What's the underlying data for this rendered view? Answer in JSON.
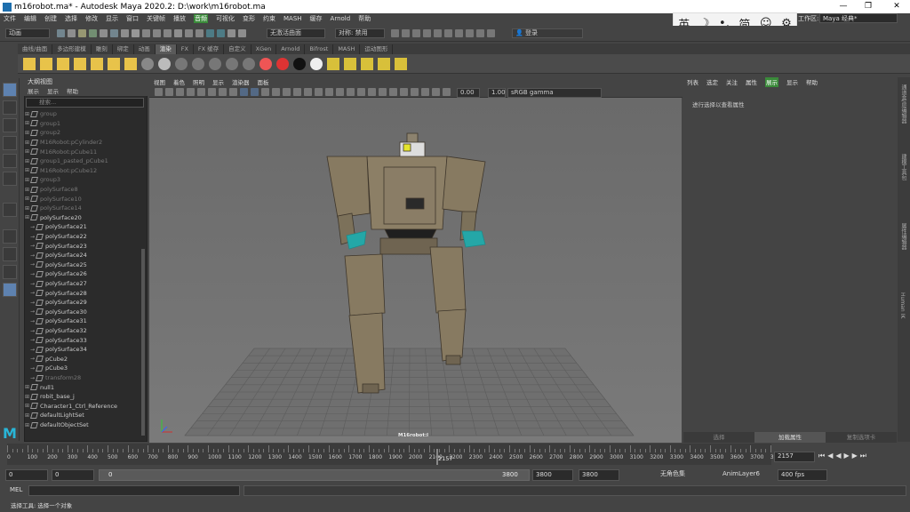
{
  "window": {
    "title": "m16robot.ma* - Autodesk Maya 2020.2: D:\\work\\m16robot.ma",
    "min": "—",
    "max": "❐",
    "close": "✕"
  },
  "menubar": [
    "文件",
    "编辑",
    "创建",
    "选择",
    "修改",
    "显示",
    "窗口",
    "关键帧",
    "播放",
    "音频",
    "可视化",
    "变形",
    "约束",
    "MASH",
    "缓存",
    "Arnold",
    "帮助"
  ],
  "menubar_highlight": "音频",
  "ime": [
    "英",
    "☽",
    "•,",
    "简",
    "☺",
    "⚙"
  ],
  "workspace": {
    "label": "工作区:",
    "value": "Maya 经典*"
  },
  "statusline": {
    "mode": "动画",
    "no_live": "无激活曲面",
    "symmetry": "对称: 禁用",
    "login": "登录"
  },
  "shelf_tabs": [
    "曲线/曲面",
    "多边形建模",
    "雕刻",
    "绑定",
    "动画",
    "渲染",
    "FX",
    "FX 缓存",
    "自定义",
    "XGen",
    "Arnold",
    "Bifrost",
    "MASH",
    "运动图形"
  ],
  "shelf_active": "渲染",
  "outliner": {
    "title": "大纲视图",
    "menu": [
      "展示",
      "显示",
      "帮助"
    ],
    "search_placeholder": "搜索...",
    "items": [
      {
        "label": "group",
        "dim": true,
        "child": false
      },
      {
        "label": "group1",
        "dim": true,
        "child": false
      },
      {
        "label": "group2",
        "dim": true,
        "child": false
      },
      {
        "label": "M16Robot:pCylinder2",
        "dim": true,
        "child": false
      },
      {
        "label": "M16Robot:pCube11",
        "dim": true,
        "child": false
      },
      {
        "label": "group1_pasted_pCube1",
        "dim": true,
        "child": false
      },
      {
        "label": "M16Robot:pCube12",
        "dim": true,
        "child": false
      },
      {
        "label": "group3",
        "dim": true,
        "child": false
      },
      {
        "label": "polySurface8",
        "dim": true,
        "child": false
      },
      {
        "label": "polySurface10",
        "dim": true,
        "child": false
      },
      {
        "label": "polySurface14",
        "dim": true,
        "child": false
      },
      {
        "label": "polySurface20",
        "dim": false,
        "child": false
      },
      {
        "label": "polySurface21",
        "dim": false,
        "child": true
      },
      {
        "label": "polySurface22",
        "dim": false,
        "child": true
      },
      {
        "label": "polySurface23",
        "dim": false,
        "child": true
      },
      {
        "label": "polySurface24",
        "dim": false,
        "child": true
      },
      {
        "label": "polySurface25",
        "dim": false,
        "child": true
      },
      {
        "label": "polySurface26",
        "dim": false,
        "child": true
      },
      {
        "label": "polySurface27",
        "dim": false,
        "child": true
      },
      {
        "label": "polySurface28",
        "dim": false,
        "child": true
      },
      {
        "label": "polySurface29",
        "dim": false,
        "child": true
      },
      {
        "label": "polySurface30",
        "dim": false,
        "child": true
      },
      {
        "label": "polySurface31",
        "dim": false,
        "child": true
      },
      {
        "label": "polySurface32",
        "dim": false,
        "child": true
      },
      {
        "label": "polySurface33",
        "dim": false,
        "child": true
      },
      {
        "label": "polySurface34",
        "dim": false,
        "child": true
      },
      {
        "label": "pCube2",
        "dim": false,
        "child": true
      },
      {
        "label": "pCube3",
        "dim": false,
        "child": true
      },
      {
        "label": "transform28",
        "dim": true,
        "child": true
      },
      {
        "label": "null1",
        "dim": false,
        "child": false
      },
      {
        "label": "robit_base_j",
        "dim": false,
        "child": false
      },
      {
        "label": "Character1_Ctrl_Reference",
        "dim": false,
        "child": false
      },
      {
        "label": "defaultLightSet",
        "dim": false,
        "child": false
      },
      {
        "label": "defaultObjectSet",
        "dim": false,
        "child": false
      }
    ]
  },
  "viewport": {
    "menu": [
      "视图",
      "着色",
      "照明",
      "显示",
      "渲染器",
      "面板"
    ],
    "exposure": "0.00",
    "gamma": "1.00",
    "color_space": "sRGB gamma",
    "camera_label": "M16robot:l"
  },
  "attribute_editor": {
    "menu": [
      "列表",
      "选定",
      "关注",
      "属性",
      "展示",
      "显示",
      "帮助"
    ],
    "menu_highlight": "展示",
    "hint": "进行选择以查看属性",
    "bottom_tabs": [
      "选择",
      "加载属性",
      "复制选项卡"
    ],
    "bottom_active": "加载属性"
  },
  "side_tabs": [
    "通道盒/层编辑器",
    "建模工具包",
    "属性编辑器",
    "Human IK"
  ],
  "timeline": {
    "ticks": [
      "0",
      "100",
      "200",
      "300",
      "400",
      "500",
      "600",
      "700",
      "800",
      "900",
      "1000",
      "1100",
      "1200",
      "1300",
      "1400",
      "1500",
      "1600",
      "1700",
      "1800",
      "1900",
      "2000",
      "2100",
      "2200",
      "2300",
      "2400",
      "2500",
      "2600",
      "2700",
      "2800",
      "2900",
      "3000",
      "3100",
      "3200",
      "3300",
      "3400",
      "3500",
      "3600",
      "3700",
      "38"
    ],
    "current_frame": "2157",
    "current_frame_field": "2157"
  },
  "range": {
    "start": "0",
    "anim_start": "0",
    "slider_start": "0",
    "slider_end": "3800",
    "anim_end": "3800",
    "end": "3800",
    "char_set": "无角色集",
    "anim_layer": "AnimLayer6",
    "fps": "400 fps"
  },
  "cmdline": {
    "label": "MEL"
  },
  "helpline": {
    "text": "选择工具: 选择一个对象"
  }
}
